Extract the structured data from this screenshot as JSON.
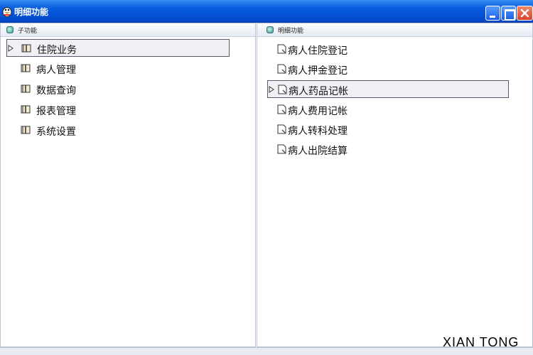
{
  "window": {
    "title": "明细功能"
  },
  "left_panel": {
    "header": "子功能",
    "items": [
      {
        "label": "住院业务",
        "selected": true,
        "icon": "book-icon"
      },
      {
        "label": "病人管理",
        "selected": false,
        "icon": "book-icon"
      },
      {
        "label": "数据查询",
        "selected": false,
        "icon": "book-icon"
      },
      {
        "label": "报表管理",
        "selected": false,
        "icon": "book-icon"
      },
      {
        "label": "系统设置",
        "selected": false,
        "icon": "book-icon"
      }
    ]
  },
  "right_panel": {
    "header": "明细功能",
    "items": [
      {
        "label": "病人住院登记",
        "selected": false,
        "icon": "document-icon"
      },
      {
        "label": "病人押金登记",
        "selected": false,
        "icon": "document-icon"
      },
      {
        "label": "病人药品记帐",
        "selected": true,
        "icon": "document-icon"
      },
      {
        "label": "病人费用记帐",
        "selected": false,
        "icon": "document-icon"
      },
      {
        "label": "病人转科处理",
        "selected": false,
        "icon": "document-icon"
      },
      {
        "label": "病人出院结算",
        "selected": false,
        "icon": "document-icon"
      }
    ]
  },
  "watermark": "XIAN TONG",
  "colors": {
    "titlebar": "#0550d6",
    "selection_border": "#5a5a6a",
    "selection_fill": "#f1f1f5"
  }
}
